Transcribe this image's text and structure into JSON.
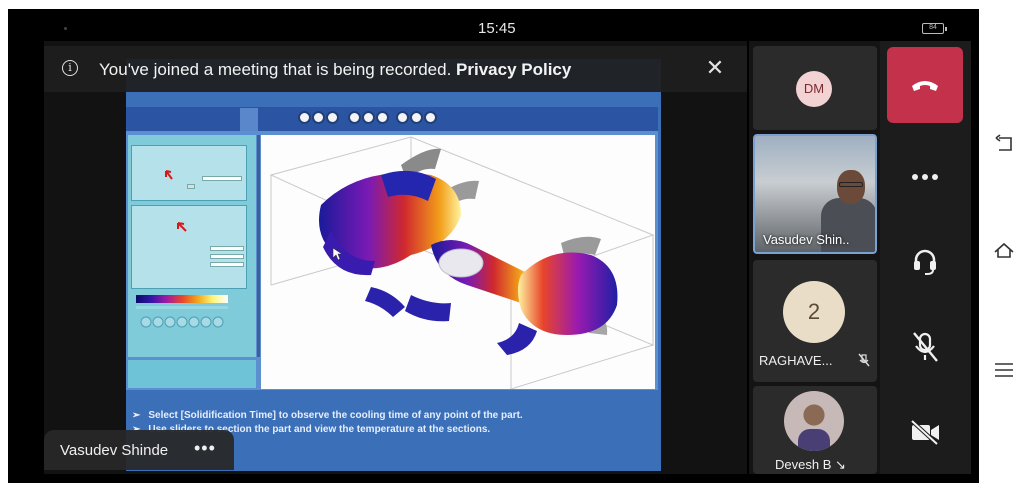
{
  "status_bar": {
    "time": "15:45",
    "battery": "84"
  },
  "banner": {
    "message": "You've joined a meeting that is being recorded.",
    "link": "Privacy Policy",
    "info_icon": "info-icon",
    "close_icon": "close-icon"
  },
  "shared_screen": {
    "presenter_name": "Vasudev Shinde",
    "slide_text": [
      "Select [Solidification Time] to observe the cooling time of any point of the part.",
      "Use sliders to section the part and view the temperature at the sections."
    ]
  },
  "participants": [
    {
      "initials": "DM",
      "avatar_color": "#f2d2d3"
    },
    {
      "name": "Vasudev Shin..",
      "video": true
    },
    {
      "name": "RAGHAVE...",
      "initial": "2",
      "muted": true
    },
    {
      "name": "Devesh B",
      "muted": true
    }
  ],
  "controls": {
    "hangup": "phone-hangup-icon",
    "more": "more-icon",
    "audio": "headset-icon",
    "mic": "mic-off-icon",
    "camera": "camera-off-icon",
    "hangup_color": "#c4314b"
  },
  "nav": [
    "back-icon",
    "home-icon",
    "recents-icon"
  ]
}
